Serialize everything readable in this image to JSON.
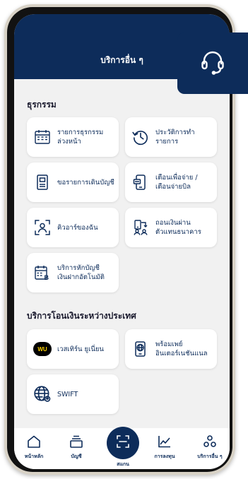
{
  "header": {
    "title": "บริการอื่น ๆ"
  },
  "sections": {
    "transactions": {
      "title": "ธุรกรรม",
      "items": [
        {
          "line1": "รายการธุรกรรม",
          "line2": "ล่วงหน้า",
          "icon": "calendar-icon"
        },
        {
          "line1": "ประวัติการทำ",
          "line2": "รายการ",
          "icon": "history-clock-icon"
        },
        {
          "line1": "ขอรายการเดินบัญชี",
          "line2": "",
          "icon": "statement-document-icon"
        },
        {
          "line1": "เตือนเพื่อจ่าย /",
          "line2": "เตือนจ่ายบิล",
          "icon": "payment-reminder-icon"
        },
        {
          "line1": "คิวอาร์ของฉัน",
          "line2": "",
          "icon": "my-qr-icon"
        },
        {
          "line1": "ถอนเงินผ่าน",
          "line2": "ตัวแทนธนาคาร",
          "icon": "bank-agent-icon"
        },
        {
          "line1": "บริการหักบัญชี",
          "line2": "เงินฝากอัตโนมัติ",
          "icon": "auto-debit-icon"
        }
      ]
    },
    "international": {
      "title": "บริการโอนเงินระหว่างประเทศ",
      "items": [
        {
          "line1": "เวสเทิร์น ยูเนี่ยน",
          "line2": "",
          "icon": "western-union-logo",
          "logo_text": "WU"
        },
        {
          "line1": "พร้อมเพย์",
          "line2": "อินเตอร์เนชันแนล",
          "icon": "promptpay-international-icon"
        },
        {
          "line1": "SWIFT",
          "line2": "",
          "icon": "globe-icon"
        }
      ]
    }
  },
  "nav": {
    "home": "หน้าหลัก",
    "account": "บัญชี",
    "scan": "สแกน",
    "invest": "การลงทุน",
    "more": "บริการอื่น ๆ"
  },
  "colors": {
    "primary": "#0d2c5a",
    "background": "#f1f1f1",
    "card": "#ffffff",
    "wu_yellow": "#ffd200"
  }
}
